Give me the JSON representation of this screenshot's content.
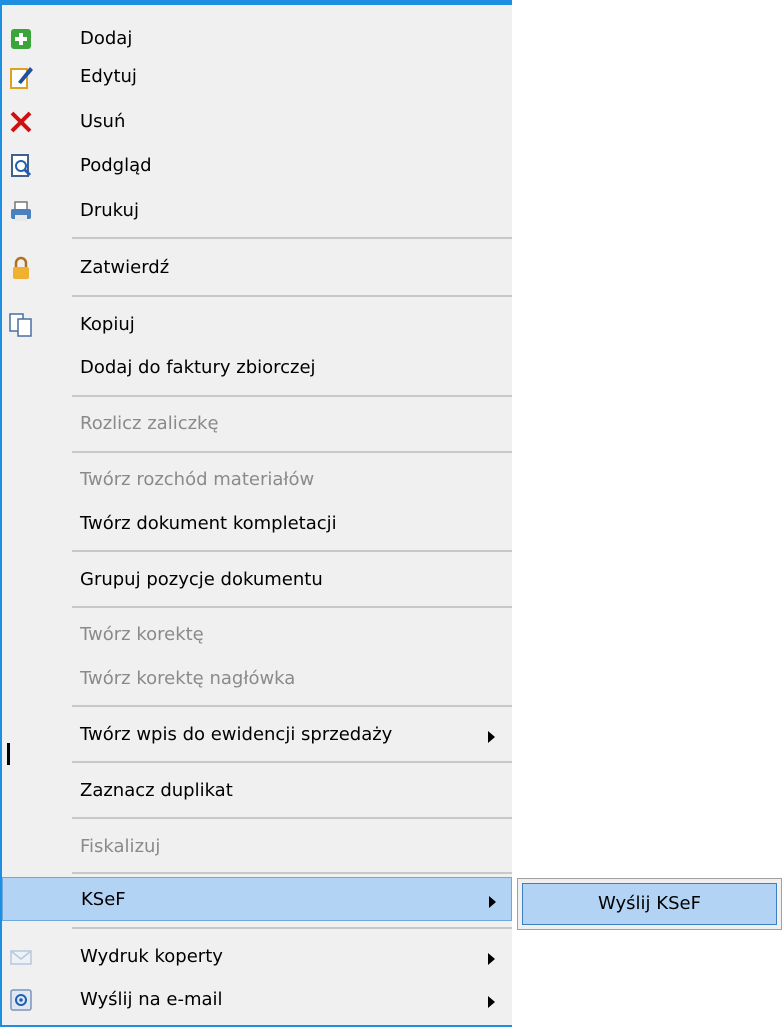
{
  "menu": {
    "items": [
      {
        "label": "Dodaj",
        "icon": "add-icon"
      },
      {
        "label": "Edytuj",
        "icon": "edit-icon"
      },
      {
        "label": "Usuń",
        "icon": "delete-icon"
      },
      {
        "label": "Podgląd",
        "icon": "preview-icon"
      },
      {
        "label": "Drukuj",
        "icon": "print-icon"
      },
      {
        "label": "Zatwierdź",
        "icon": "lock-icon"
      },
      {
        "label": "Kopiuj",
        "icon": "copy-icon"
      },
      {
        "label": "Dodaj do faktury zbiorczej"
      },
      {
        "label": "Rozlicz zaliczkę",
        "disabled": true
      },
      {
        "label": "Twórz rozchód materiałów",
        "disabled": true
      },
      {
        "label": "Twórz dokument kompletacji"
      },
      {
        "label": "Grupuj pozycje dokumentu"
      },
      {
        "label": "Twórz korektę",
        "disabled": true
      },
      {
        "label": "Twórz korektę nagłówka",
        "disabled": true
      },
      {
        "label": "Twórz wpis do ewidencji sprzedaży",
        "submenu": true
      },
      {
        "label": "Zaznacz duplikat"
      },
      {
        "label": "Fiskalizuj",
        "disabled": true
      },
      {
        "label": "KSeF",
        "submenu": true,
        "selected": true
      },
      {
        "label": "Wydruk koperty",
        "submenu": true,
        "icon": "envelope-icon"
      },
      {
        "label": "Wyślij na e-mail",
        "submenu": true,
        "icon": "email-icon"
      }
    ]
  },
  "submenu": {
    "label": "Wyślij KSeF"
  },
  "colors": {
    "accent": "#1e8fe0",
    "highlight": "#b3d3f5",
    "disabled": "#8a8a8a"
  }
}
